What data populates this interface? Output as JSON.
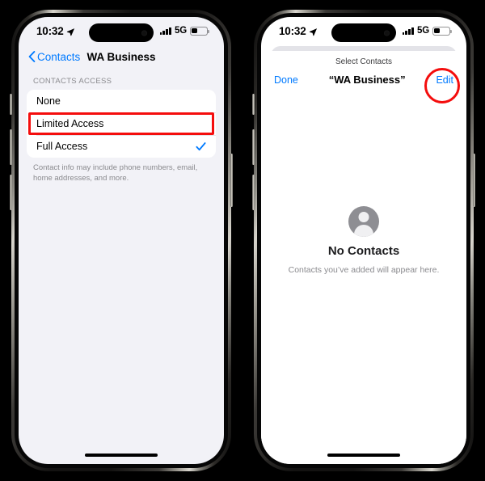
{
  "colors": {
    "ios_blue": "#007aff",
    "annotation_red": "#f40d0d",
    "grouped_background": "#f2f2f7",
    "secondary_label": "#8a8a8e"
  },
  "status_bar": {
    "time": "10:32",
    "location_icon": "location-arrow-icon",
    "signal_icon": "cellular-bars-icon",
    "network": "5G",
    "battery_icon": "battery-icon"
  },
  "left_phone": {
    "nav": {
      "back_label": "Contacts",
      "back_icon": "chevron-left-icon",
      "title": "WA Business"
    },
    "section_header": "CONTACTS ACCESS",
    "options": [
      {
        "label": "None",
        "selected": false
      },
      {
        "label": "Limited Access",
        "selected": false,
        "highlighted": true
      },
      {
        "label": "Full Access",
        "selected": true
      }
    ],
    "checkmark_icon": "checkmark-icon",
    "footnote": "Contact info may include phone numbers, email, home addresses, and more."
  },
  "right_phone": {
    "sheet": {
      "header": "Select Contacts",
      "done_label": "Done",
      "title": "“WA Business”",
      "edit_label": "Edit",
      "edit_highlighted": true
    },
    "empty_state": {
      "avatar_icon": "person-avatar-icon",
      "title": "No Contacts",
      "subtitle": "Contacts you’ve added will appear here."
    }
  }
}
